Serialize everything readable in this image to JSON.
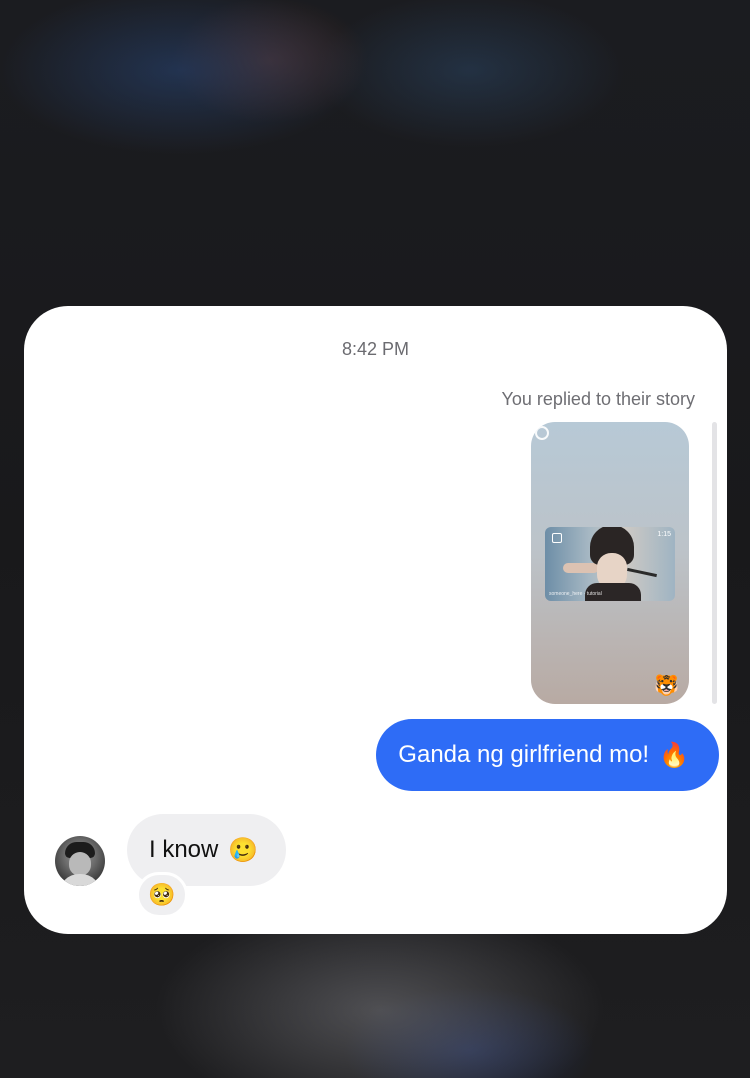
{
  "conversation": {
    "timestamp": "8:42 PM",
    "story_reply": {
      "caption": "You replied to their story",
      "inner_time": "1:15",
      "inner_caption": "someone_here · tutorial",
      "sticker": "🐯"
    },
    "messages": [
      {
        "direction": "outgoing",
        "text": "Ganda ng girlfriend mo!",
        "emoji": "🔥"
      },
      {
        "direction": "incoming",
        "text": "I know",
        "emoji": "🥲",
        "reaction": "🥺"
      }
    ]
  },
  "colors": {
    "outgoing_bubble": "#2e6cf6",
    "incoming_bubble": "#efeff1",
    "card_background": "#ffffff",
    "backdrop": "#1c1c1e"
  },
  "icons": {
    "avatar": "contact-avatar",
    "story_check": "check-circle-icon"
  }
}
